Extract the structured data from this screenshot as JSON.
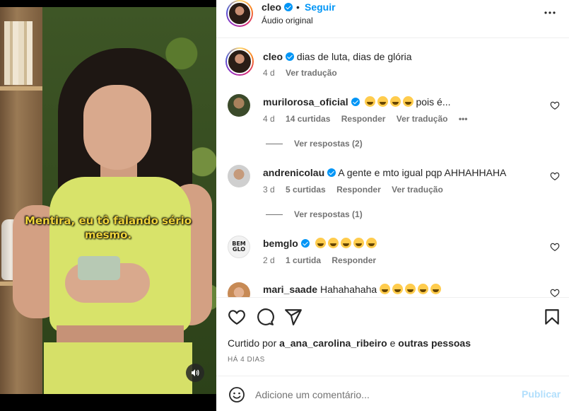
{
  "video": {
    "subtitle": "Mentira, eu tô falando sério mesmo."
  },
  "header": {
    "username": "cleo",
    "separator": "•",
    "follow_label": "Seguir",
    "subtitle": "Áudio original",
    "more_icon": "more-horizontal-icon"
  },
  "caption": {
    "username": "cleo",
    "text": "dias de luta, dias de glória",
    "time": "4 d",
    "translate": "Ver tradução"
  },
  "comments": [
    {
      "username": "murilorosa_oficial",
      "verified": true,
      "emoji_count": 4,
      "text": "pois é...",
      "time": "4 d",
      "likes": "14 curtidas",
      "reply": "Responder",
      "translate": "Ver tradução",
      "more": "•••",
      "view_replies": "Ver respostas (2)"
    },
    {
      "username": "andrenicolau",
      "verified": true,
      "text": "A gente e mto igual pqp AHHAHHAHA",
      "time": "3 d",
      "likes": "5 curtidas",
      "reply": "Responder",
      "translate": "Ver tradução",
      "view_replies": "Ver respostas (1)"
    },
    {
      "username": "bemglo",
      "verified": true,
      "avatar_text": "BEM GLO",
      "emoji_count": 5,
      "time": "2 d",
      "likes": "1 curtida",
      "reply": "Responder"
    },
    {
      "username": "mari_saade",
      "verified": false,
      "text": "Hahahahaha",
      "emoji_count": 5
    }
  ],
  "actions": {
    "liked_by_prefix": "Curtido por",
    "liked_by_user": "a_ana_carolina_ribeiro",
    "liked_by_conj": "e",
    "liked_by_others": "outras pessoas",
    "date": "HÁ 4 DIAS"
  },
  "add_comment": {
    "placeholder": "Adicione um comentário...",
    "publish_label": "Publicar"
  },
  "colors": {
    "accent": "#0095f6",
    "subtitle": "#f0d43b",
    "muted_text": "#737373",
    "publish_disabled": "#b2dffc"
  }
}
